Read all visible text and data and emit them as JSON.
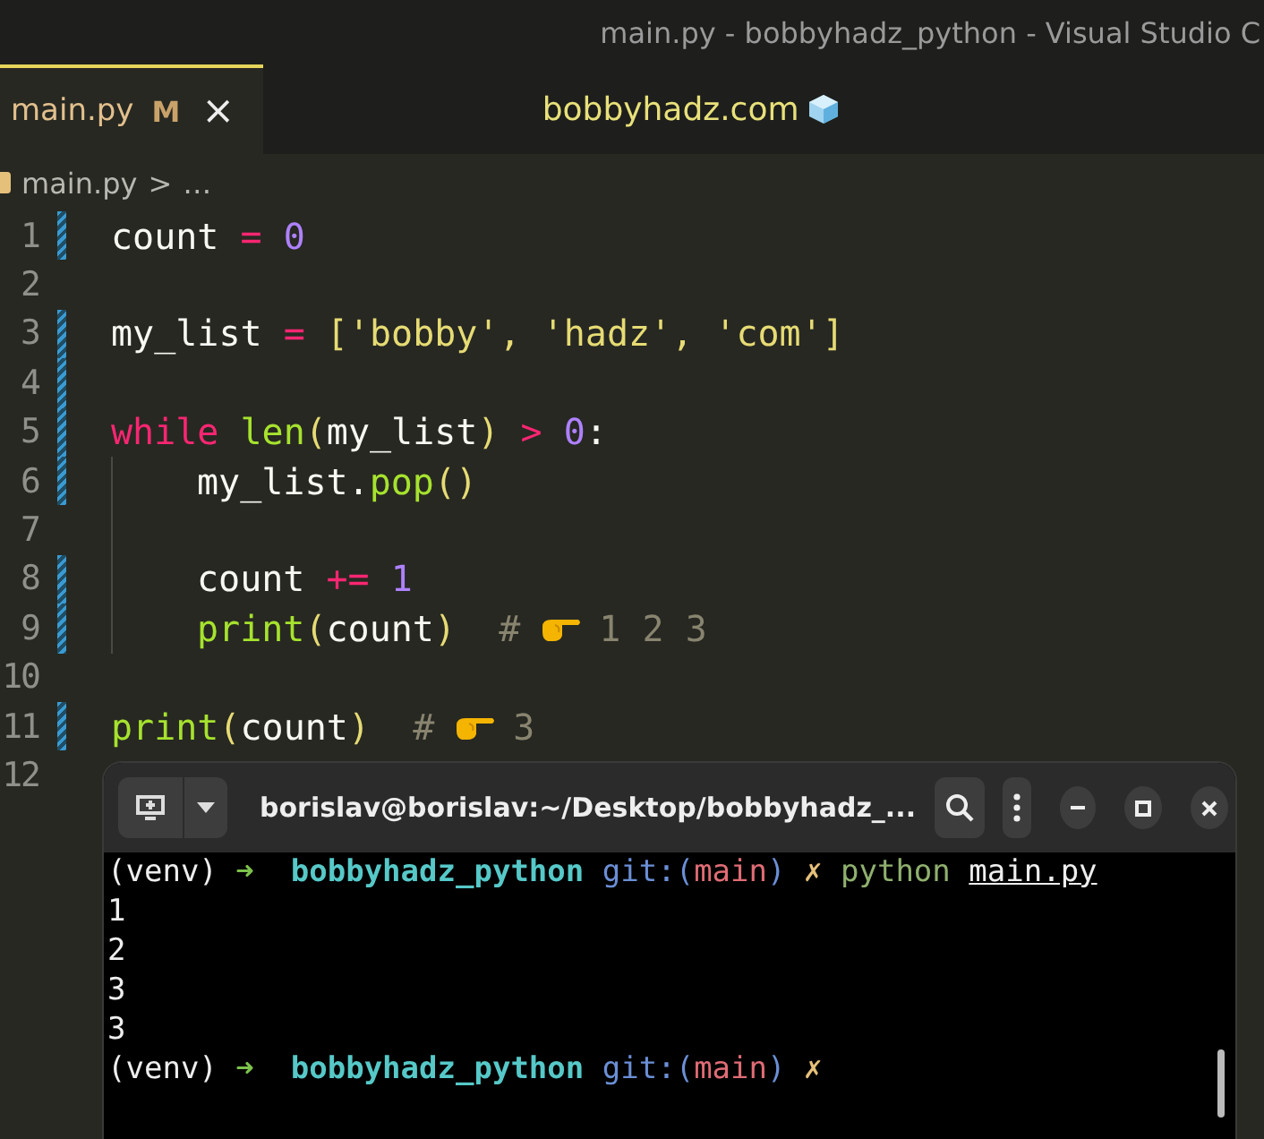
{
  "window": {
    "title": "main.py - bobbyhadz_python - Visual Studio C"
  },
  "tabs": [
    {
      "label": "main.py",
      "badge": "M",
      "close": "×",
      "selected": true
    }
  ],
  "banner": {
    "text": "bobbyhadz.com"
  },
  "breadcrumb": {
    "file": "main.py",
    "separator": ">",
    "more": "…"
  },
  "code": {
    "lines": [
      {
        "number": "1",
        "changed": true,
        "tokens": [
          {
            "kind": "var",
            "text": "count"
          },
          {
            "kind": "op",
            "text": " = "
          },
          {
            "kind": "num",
            "text": "0"
          }
        ]
      },
      {
        "number": "2",
        "changed": false
      },
      {
        "number": "3",
        "changed": true,
        "tokens": [
          {
            "kind": "var",
            "text": "my_list"
          },
          {
            "kind": "op",
            "text": " = "
          },
          {
            "kind": "punc",
            "text": "['bobby', 'hadz', 'com']"
          }
        ]
      },
      {
        "number": "4",
        "changed": true
      },
      {
        "number": "5",
        "changed": true,
        "tokens": [
          {
            "kind": "keyword",
            "text": "while "
          },
          {
            "kind": "func",
            "text": "len"
          },
          {
            "kind": "punc",
            "text": "("
          },
          {
            "kind": "var",
            "text": "my_list"
          },
          {
            "kind": "punc",
            "text": ")"
          },
          {
            "kind": "op",
            "text": " > "
          },
          {
            "kind": "num",
            "text": "0"
          },
          {
            "kind": "var",
            "text": ":"
          }
        ],
        "children": [
          {
            "number": "6",
            "changed": true,
            "tokens": [
              {
                "kind": "var",
                "text": "my_list."
              },
              {
                "kind": "func",
                "text": "pop"
              },
              {
                "kind": "punc",
                "text": "()"
              }
            ]
          },
          {
            "number": "7",
            "changed": false
          },
          {
            "number": "8",
            "changed": true,
            "tokens": [
              {
                "kind": "var",
                "text": "count"
              },
              {
                "kind": "op",
                "text": " += "
              },
              {
                "kind": "num",
                "text": "1"
              }
            ]
          },
          {
            "number": "9",
            "changed": true,
            "tokens": [
              {
                "kind": "func",
                "text": "print"
              },
              {
                "kind": "punc",
                "text": "("
              },
              {
                "kind": "var",
                "text": "count"
              },
              {
                "kind": "punc",
                "text": ")"
              },
              {
                "kind": "comment",
                "text": "  #"
              },
              {
                "kind": "pointer"
              },
              {
                "kind": "comment",
                "text": "1 2 3"
              }
            ]
          }
        ]
      },
      {
        "number": "10",
        "changed": false
      },
      {
        "number": "11",
        "changed": true,
        "tokens": [
          {
            "kind": "func",
            "text": "print"
          },
          {
            "kind": "punc",
            "text": "("
          },
          {
            "kind": "var",
            "text": "count"
          },
          {
            "kind": "punc",
            "text": ")"
          },
          {
            "kind": "comment",
            "text": "  #"
          },
          {
            "kind": "pointer"
          },
          {
            "kind": "comment",
            "text": "3"
          }
        ]
      },
      {
        "number": "12",
        "changed": false
      }
    ]
  },
  "terminal": {
    "title": "borislav@borislav:~/Desktop/bobbyhadz_...",
    "lines": [
      [
        {
          "kind": "plain",
          "text": "(venv) "
        },
        {
          "kind": "arrow",
          "text": "➜  "
        },
        {
          "kind": "dir",
          "text": "bobbyhadz_python "
        },
        {
          "kind": "git",
          "text": "git:("
        },
        {
          "kind": "branch",
          "text": "main"
        },
        {
          "kind": "git",
          "text": ") "
        },
        {
          "kind": "dirty",
          "text": "✗ "
        },
        {
          "kind": "cmd",
          "text": "python "
        },
        {
          "kind": "arg",
          "text": "main.py"
        }
      ],
      [
        {
          "kind": "plain",
          "text": "1"
        }
      ],
      [
        {
          "kind": "plain",
          "text": "2"
        }
      ],
      [
        {
          "kind": "plain",
          "text": "3"
        }
      ],
      [
        {
          "kind": "plain",
          "text": "3"
        }
      ],
      [
        {
          "kind": "plain",
          "text": "(venv) "
        },
        {
          "kind": "arrow",
          "text": "➜  "
        },
        {
          "kind": "dir",
          "text": "bobbyhadz_python "
        },
        {
          "kind": "git",
          "text": "git:("
        },
        {
          "kind": "branch",
          "text": "main"
        },
        {
          "kind": "git",
          "text": ") "
        },
        {
          "kind": "dirty",
          "text": "✗"
        }
      ]
    ]
  }
}
